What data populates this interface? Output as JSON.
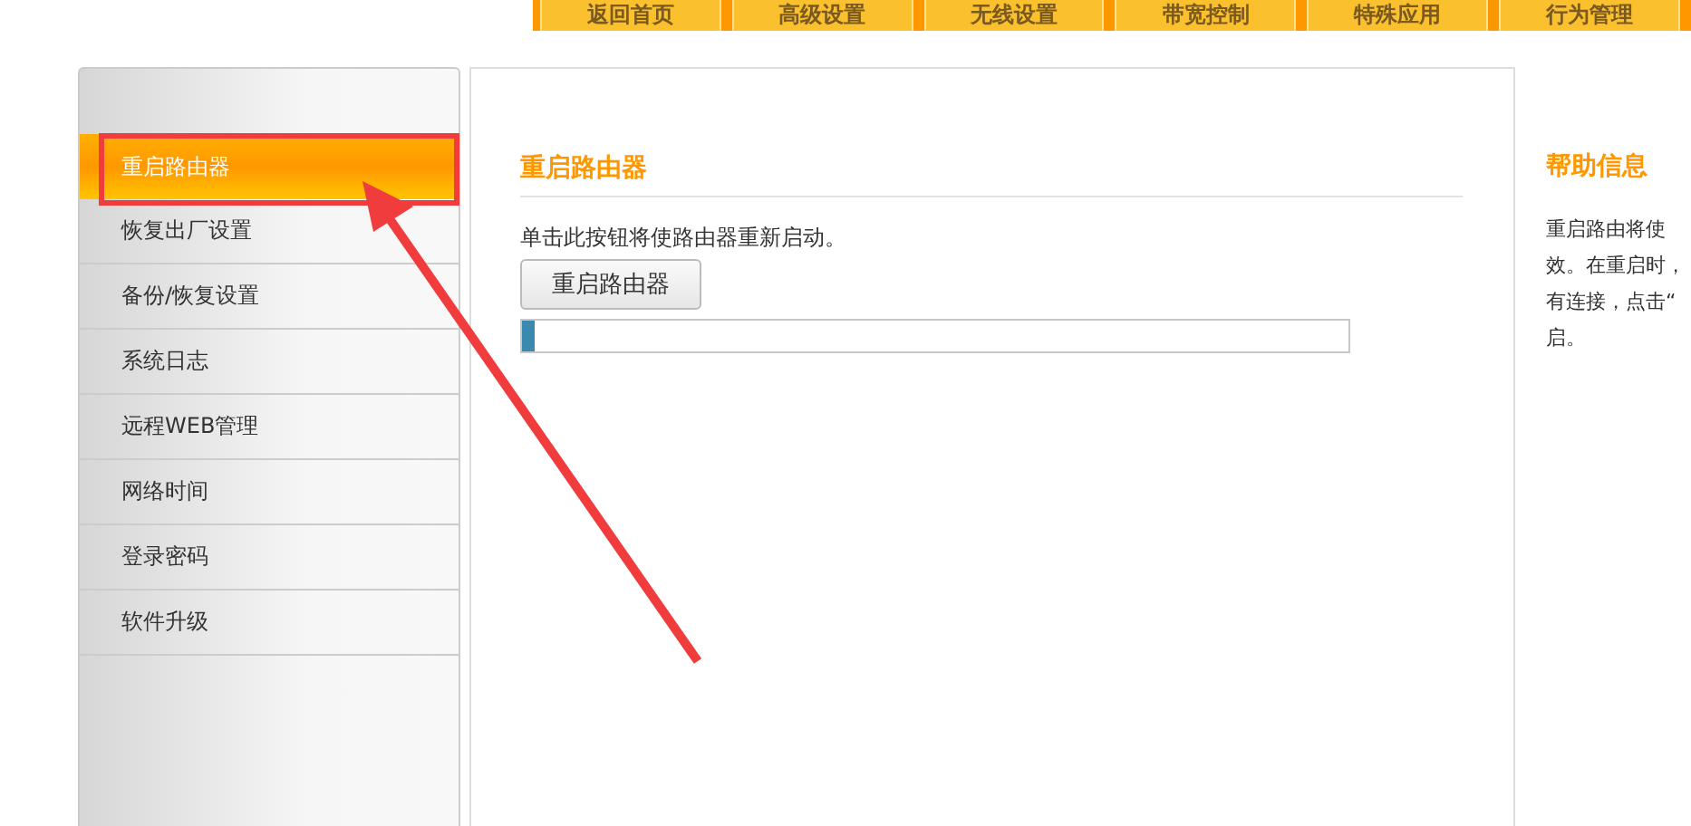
{
  "top_nav": [
    {
      "label": "返回首页",
      "selected": false
    },
    {
      "label": "高级设置",
      "selected": false
    },
    {
      "label": "无线设置",
      "selected": false
    },
    {
      "label": "带宽控制",
      "selected": false
    },
    {
      "label": "特殊应用",
      "selected": false
    },
    {
      "label": "行为管理",
      "selected": false
    }
  ],
  "sidebar": {
    "items": [
      {
        "label": "重启路由器",
        "selected": true
      },
      {
        "label": "恢复出厂设置",
        "selected": false
      },
      {
        "label": "备份/恢复设置",
        "selected": false
      },
      {
        "label": "系统日志",
        "selected": false
      },
      {
        "label": "远程WEB管理",
        "selected": false
      },
      {
        "label": "网络时间",
        "selected": false
      },
      {
        "label": "登录密码",
        "selected": false
      },
      {
        "label": "软件升级",
        "selected": false
      }
    ]
  },
  "main": {
    "title": "重启路由器",
    "description": "单击此按钮将使路由器重新启动。",
    "button": "重启路由器",
    "progress": {
      "level": 0.015
    }
  },
  "help": {
    "title": "帮助信息",
    "lines": [
      "重启路由将使",
      "效。在重启时，",
      "有连接，点击“",
      "启。"
    ]
  }
}
